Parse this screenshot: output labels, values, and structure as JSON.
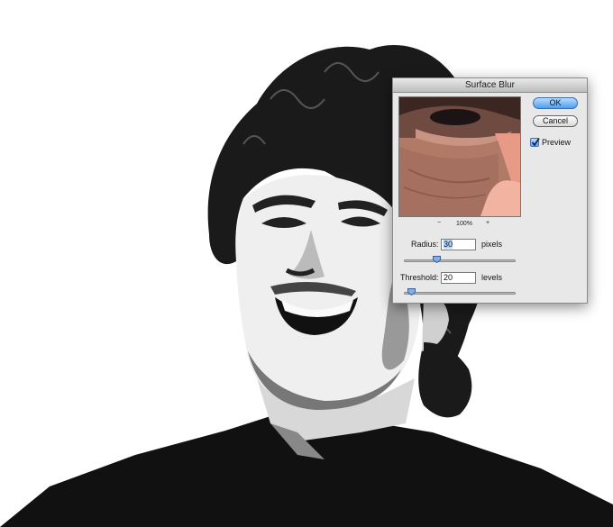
{
  "dialog": {
    "title": "Surface Blur",
    "ok_label": "OK",
    "cancel_label": "Cancel",
    "preview_label": "Preview",
    "preview_checked": true,
    "zoom": {
      "minus": "−",
      "level": "100%",
      "plus": "+"
    },
    "radius": {
      "label": "Radius:",
      "value": "30",
      "unit": "pixels",
      "slider_fraction": 0.3
    },
    "threshold": {
      "label": "Threshold:",
      "value": "20",
      "unit": "levels",
      "slider_fraction": 0.08
    }
  },
  "colors": {
    "ok_button": "#4f9ef0",
    "dialog_bg": "#e8e8e8",
    "skin_preview": "#a8735f"
  }
}
